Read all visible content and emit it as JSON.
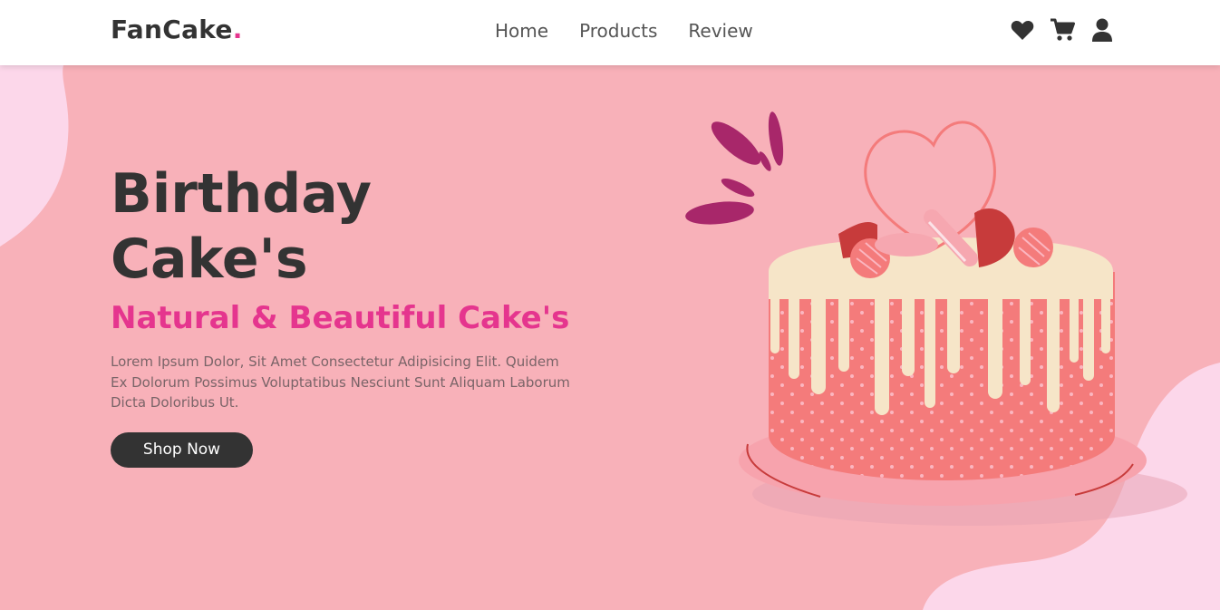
{
  "header": {
    "logo_text": "FanCake",
    "logo_dot": ".",
    "nav": [
      {
        "label": "Home"
      },
      {
        "label": "Products"
      },
      {
        "label": "Review"
      }
    ],
    "icons": [
      "heart-icon",
      "cart-icon",
      "user-icon"
    ]
  },
  "hero": {
    "title_line1": "Birthday",
    "title_line2": "Cake's",
    "subtitle": "Natural & Beautiful Cake's",
    "description": "Lorem Ipsum Dolor, Sit Amet Consectetur Adipisicing Elit. Quidem Ex Dolorum Possimus Voluptatibus Nesciunt Sunt Aliquam Laborum Dicta Doloribus Ut.",
    "button_label": "Shop Now"
  },
  "colors": {
    "background": "#f8b1b9",
    "accent": "#e5358e",
    "dark": "#333333",
    "blob": "#fcd7ea"
  }
}
